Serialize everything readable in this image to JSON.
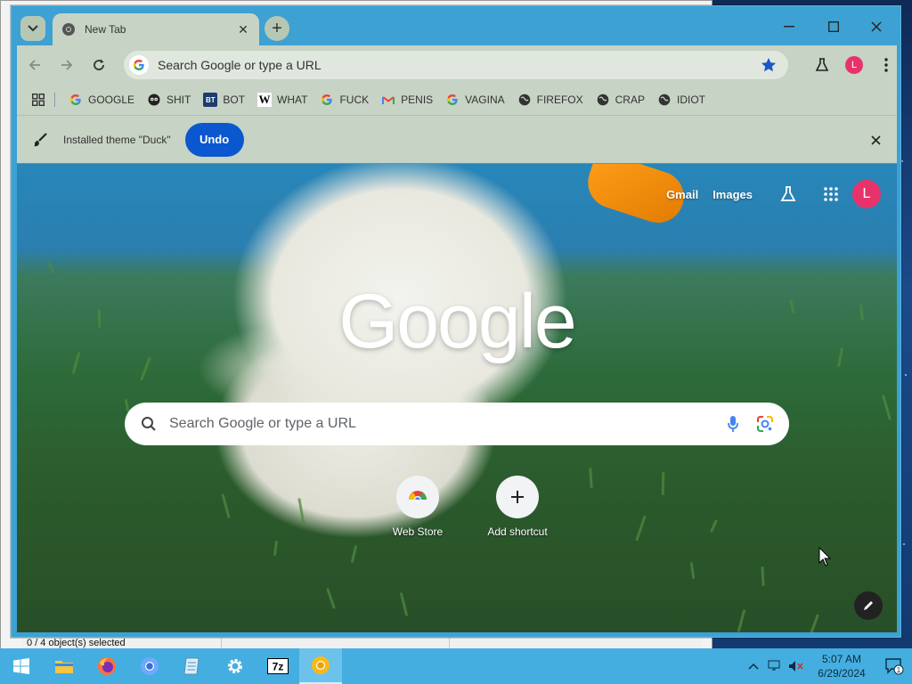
{
  "background_window": {
    "status_text": "0 / 4 object(s) selected"
  },
  "browser": {
    "tab": {
      "title": "New Tab"
    },
    "omnibox": {
      "placeholder": "Search Google or type a URL"
    },
    "profile_initial": "L",
    "bookmarks": [
      {
        "label": "GOOGLE",
        "icon": "google-icon"
      },
      {
        "label": "SHIT",
        "icon": "owl-icon"
      },
      {
        "label": "BOT",
        "icon": "bt-icon"
      },
      {
        "label": "WHAT",
        "icon": "w-icon"
      },
      {
        "label": "FUCK",
        "icon": "google-icon"
      },
      {
        "label": "PENIS",
        "icon": "gmail-icon"
      },
      {
        "label": "VAGINA",
        "icon": "google-icon"
      },
      {
        "label": "FIREFOX",
        "icon": "globe-icon"
      },
      {
        "label": "CRAP",
        "icon": "globe-icon"
      },
      {
        "label": "IDIOT",
        "icon": "globe-icon"
      }
    ],
    "infobar": {
      "message": "Installed theme \"Duck\"",
      "undo_label": "Undo"
    }
  },
  "ntp": {
    "links": {
      "gmail": "Gmail",
      "images": "Images"
    },
    "profile_initial": "L",
    "logo_text": "Google",
    "search_placeholder": "Search Google or type a URL",
    "shortcuts": [
      {
        "label": "Web Store",
        "icon": "chrome-webstore-icon"
      },
      {
        "label": "Add shortcut",
        "icon": "plus-icon"
      }
    ]
  },
  "taskbar": {
    "apps": [
      {
        "name": "file-explorer",
        "icon": "folder-icon"
      },
      {
        "name": "firefox",
        "icon": "firefox-icon"
      },
      {
        "name": "chromium",
        "icon": "chromium-icon"
      },
      {
        "name": "notepad",
        "icon": "notepad-icon"
      },
      {
        "name": "settings",
        "icon": "gear-icon"
      },
      {
        "name": "7zip",
        "icon": "7z-icon"
      },
      {
        "name": "chrome-canary",
        "icon": "chrome-canary-icon",
        "active": true
      }
    ],
    "clock": {
      "time": "5:07 AM",
      "date": "6/29/2024"
    },
    "notification_count": "1"
  },
  "colors": {
    "window_frame": "#3da1d3",
    "toolbar": "#c7d3c4",
    "undo_button": "#0b57d0",
    "avatar": "#e8336a",
    "taskbar": "#45aee0"
  }
}
